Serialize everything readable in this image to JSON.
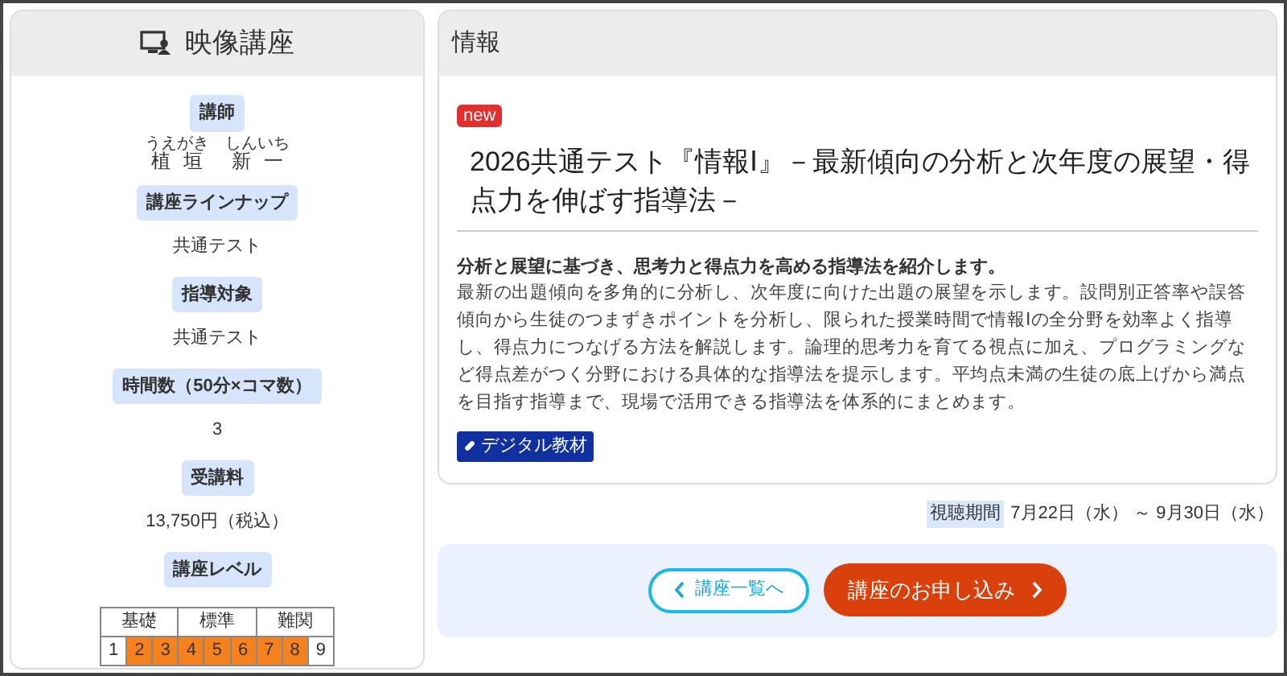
{
  "sidebar": {
    "title": "映像講座",
    "fields": [
      {
        "kind": "ruby",
        "label": "講師",
        "parts": [
          {
            "text": "植垣",
            "reading": "うえがき"
          },
          {
            "text": "新一",
            "reading": "しんいち"
          }
        ]
      },
      {
        "kind": "text",
        "label": "講座ラインナップ",
        "value": "共通テスト"
      },
      {
        "kind": "text",
        "label": "指導対象",
        "value": "共通テスト"
      },
      {
        "kind": "text",
        "label": "時間数（50分×コマ数）",
        "value": "3"
      },
      {
        "kind": "text",
        "label": "受講料",
        "value": "13,750円（税込）"
      },
      {
        "kind": "level",
        "label": "講座レベル",
        "groups": [
          "基礎",
          "標準",
          "難関"
        ],
        "cells": [
          {
            "label": "1",
            "on": false
          },
          {
            "label": "2",
            "on": true
          },
          {
            "label": "3",
            "on": true
          },
          {
            "label": "4",
            "on": true
          },
          {
            "label": "5",
            "on": true
          },
          {
            "label": "6",
            "on": true
          },
          {
            "label": "7",
            "on": true
          },
          {
            "label": "8",
            "on": true
          },
          {
            "label": "9",
            "on": false
          }
        ]
      }
    ]
  },
  "main": {
    "header": "情報",
    "badge": "new",
    "title": "2026共通テスト『情報Ⅰ』－最新傾向の分析と次年度の展望・得点力を伸ばす指導法－",
    "lead": "分析と展望に基づき、思考力と得点力を高める指導法を紹介します。",
    "body": "最新の出題傾向を多角的に分析し、次年度に向けた出題の展望を示します。設問別正答率や誤答傾向から生徒のつまずきポイントを分析し、限られた授業時間で情報Ⅰの全分野を効率よく指導し、得点力につなげる方法を解説します。論理的思考力を育てる視点に加え、プログラミングなど得点差がつく分野における具体的な指導法を提示します。平均点未満の生徒の底上げから満点を目指す指導まで、現場で活用できる指導法を体系的にまとめます。",
    "tag": "デジタル教材"
  },
  "period": {
    "label": "視聴期間",
    "value": "7月22日（水） ～ 9月30日（水）"
  },
  "buttons": [
    {
      "kind": "back",
      "label": "講座一覧へ"
    },
    {
      "kind": "apply",
      "label": "講座のお申し込み"
    }
  ]
}
